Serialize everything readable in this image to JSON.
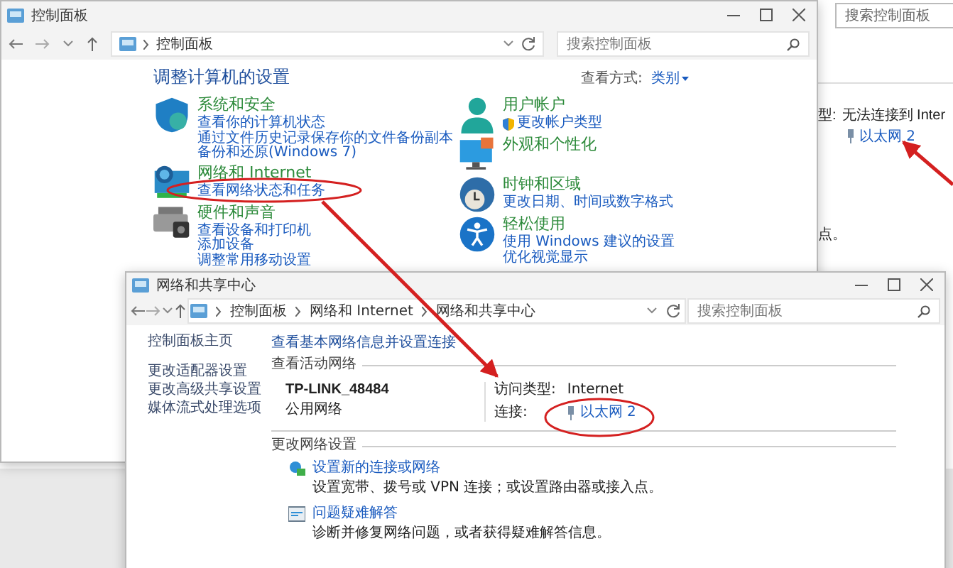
{
  "background_window": {
    "search": {
      "placeholder": "搜索控制面板"
    },
    "type_label": "型:",
    "type_value": "无法连接到 Inter",
    "connection_link": "以太网 2",
    "fragment": "点。"
  },
  "control_panel": {
    "title": "控制面板",
    "breadcrumb": [
      "控制面板"
    ],
    "search": {
      "placeholder": "搜索控制面板"
    },
    "heading": "调整计算机的设置",
    "view_by_label": "查看方式:",
    "view_by_value": "类别",
    "columns": [
      [
        {
          "title": "系统和安全",
          "links": [
            {
              "text": "查看你的计算机状态",
              "kind": "plain"
            },
            {
              "text": "通过文件历史记录保存你的文件备份副本",
              "kind": "plain"
            },
            {
              "text": "备份和还原(Windows 7)",
              "kind": "plain"
            }
          ]
        },
        {
          "title": "网络和 Internet",
          "links": [
            {
              "text": "查看网络状态和任务",
              "kind": "plain"
            }
          ]
        },
        {
          "title": "硬件和声音",
          "links": [
            {
              "text": "查看设备和打印机",
              "kind": "plain"
            },
            {
              "text": "添加设备",
              "kind": "plain"
            },
            {
              "text": "调整常用移动设置",
              "kind": "plain"
            }
          ]
        }
      ],
      [
        {
          "title": "用户帐户",
          "links": [
            {
              "text": "更改帐户类型",
              "kind": "admin"
            }
          ]
        },
        {
          "title": "外观和个性化"
        },
        {
          "title": "时钟和区域",
          "links": [
            {
              "text": "更改日期、时间或数字格式",
              "kind": "plain"
            }
          ]
        },
        {
          "title": "轻松使用",
          "links": [
            {
              "text": "使用 Windows 建议的设置",
              "kind": "plain"
            },
            {
              "text": "优化视觉显示",
              "kind": "plain"
            }
          ]
        }
      ]
    ]
  },
  "network_window": {
    "title": "网络和共享中心",
    "breadcrumb": [
      "控制面板",
      "网络和 Internet",
      "网络和共享中心"
    ],
    "search": {
      "placeholder": "搜索控制面板"
    },
    "sidebar": {
      "items": [
        "控制面板主页",
        "更改适配器设置",
        "更改高级共享设置",
        "媒体流式处理选项"
      ]
    },
    "heading": "查看基本网络信息并设置连接",
    "active_section": "查看活动网络",
    "network": {
      "name": "TP-LINK_48484",
      "type": "公用网络",
      "access_label": "访问类型:",
      "access_value": "Internet",
      "connection_label": "连接:",
      "connection_value": "以太网 2"
    },
    "change_section": "更改网络设置",
    "tasks": [
      {
        "title": "设置新的连接或网络",
        "description": "设置宽带、拨号或 VPN 连接；或设置路由器或接入点。"
      },
      {
        "title": "问题疑难解答",
        "description": "诊断并修复网络问题，或者获得疑难解答信息。"
      }
    ]
  }
}
